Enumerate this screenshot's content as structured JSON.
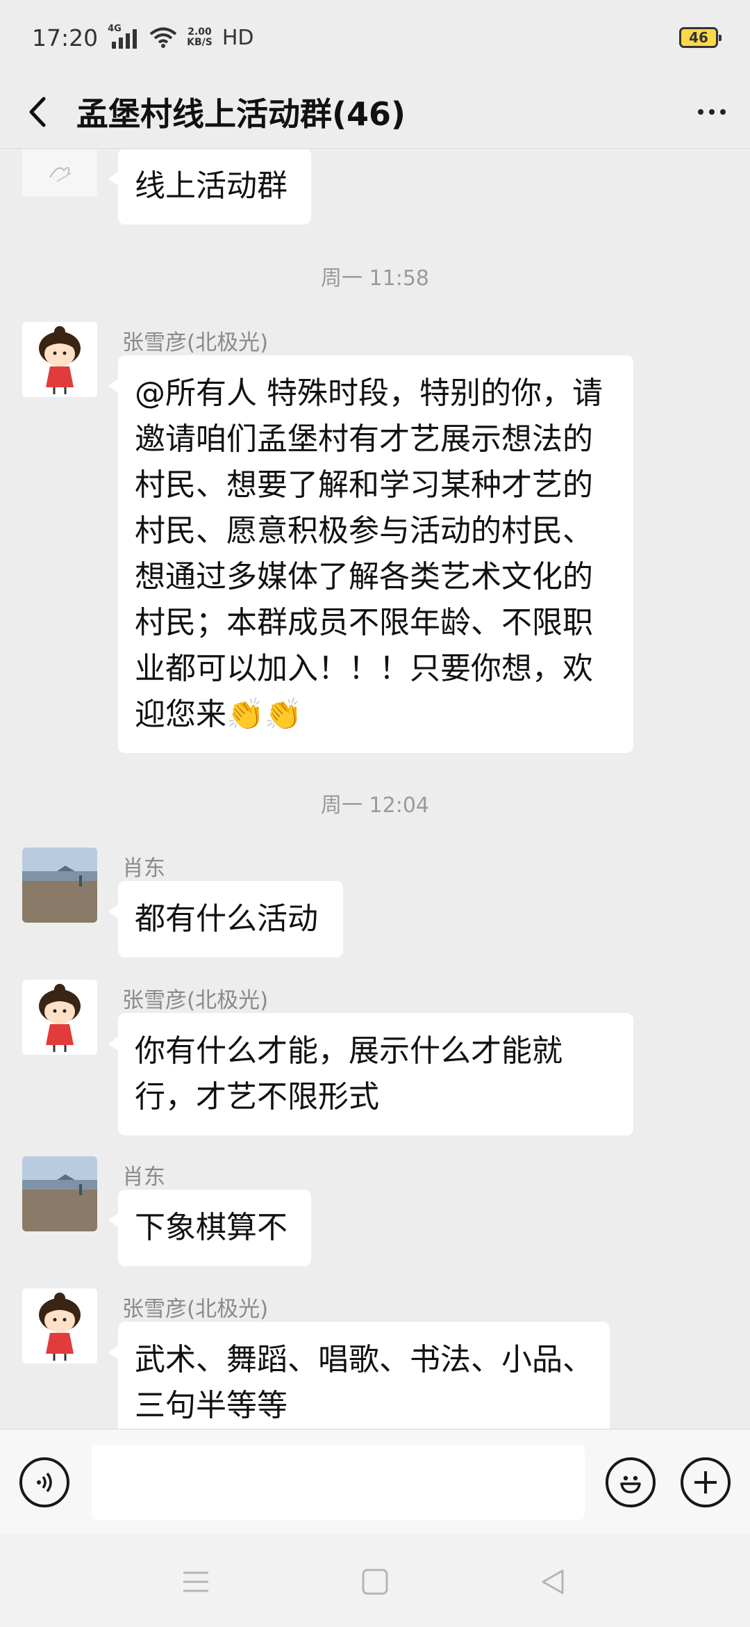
{
  "status_bar": {
    "time": "17:20",
    "network_label": "4G",
    "net_speed_value": "2.00",
    "net_speed_unit": "KB/S",
    "hd_label": "HD",
    "battery": "46"
  },
  "header": {
    "title": "孟堡村线上活动群(46)"
  },
  "messages": [
    {
      "sender": "",
      "text": "线上活动群"
    },
    {
      "sender": "张雪彦(北极光)",
      "text": "@所有人 特殊时段，特别的你，请邀请咱们孟堡村有才艺展示想法的村民、想要了解和学习某种才艺的村民、愿意积极参与活动的村民、想通过多媒体了解各类艺术文化的村民；本群成员不限年龄、不限职业都可以加入！！！只要你想，欢迎您来👏👏"
    },
    {
      "sender": "肖东",
      "text": "都有什么活动"
    },
    {
      "sender": "张雪彦(北极光)",
      "text": "你有什么才能，展示什么才能就行，才艺不限形式"
    },
    {
      "sender": "肖东",
      "text": "下象棋算不"
    },
    {
      "sender": "张雪彦(北极光)",
      "text": "武术、舞蹈、唱歌、书法、小品、三句半等等"
    }
  ],
  "timestamps": [
    "周一 11:58",
    "周一 12:04"
  ],
  "input": {
    "value": "",
    "placeholder": ""
  },
  "icons": {
    "back": "chevron-left-icon",
    "more": "more-dots-icon",
    "voice": "voice-icon",
    "emoji": "emoji-icon",
    "plus": "plus-icon",
    "nav_menu": "menu-icon",
    "nav_home": "home-icon",
    "nav_back": "back-triangle-icon"
  },
  "colors": {
    "background": "#ededed",
    "bubble": "#ffffff",
    "text": "#111111",
    "muted": "#8a8a8a",
    "battery": "#ffd84a"
  }
}
